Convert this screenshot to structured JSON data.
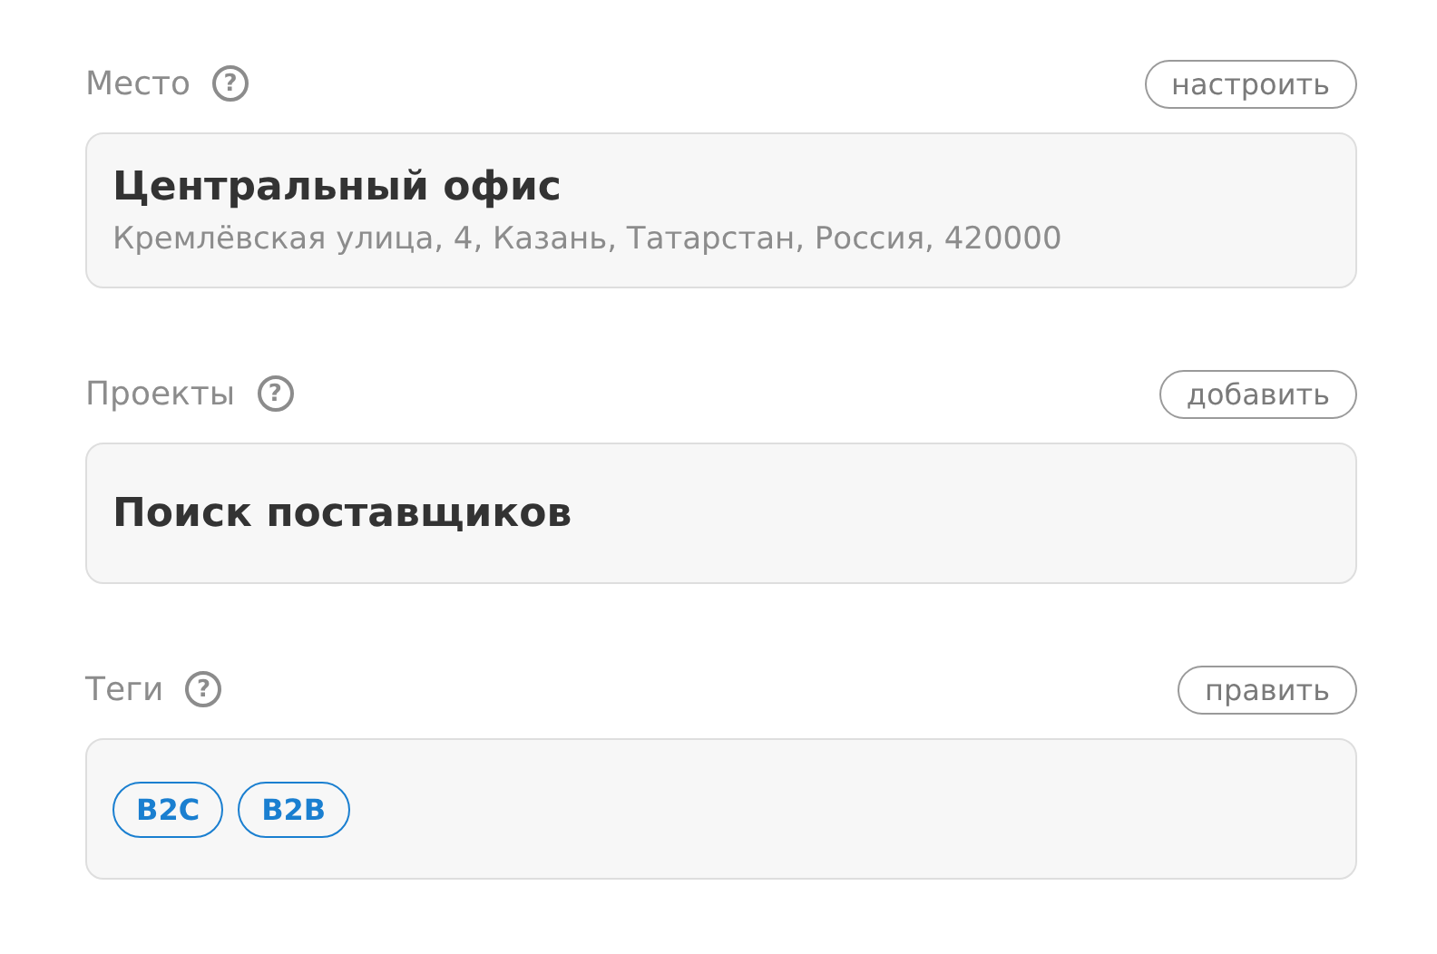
{
  "sections": [
    {
      "kind": "place",
      "label": "Место",
      "hint": "?",
      "action": "настроить",
      "title": "Центральный офис",
      "subtitle": "Кремлёвская улица, 4, Казань, Татарстан, Россия, 420000"
    },
    {
      "kind": "list",
      "label": "Проекты",
      "hint": "?",
      "action": "добавить",
      "items": [
        "Поиск поставщиков"
      ]
    },
    {
      "kind": "tags",
      "label": "Теги",
      "hint": "?",
      "action": "править",
      "tags": [
        "B2C",
        "B2B"
      ]
    }
  ]
}
